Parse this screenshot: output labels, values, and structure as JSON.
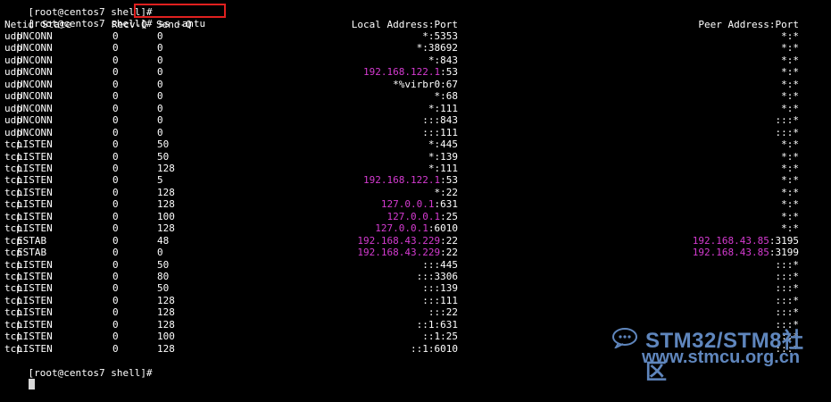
{
  "terminal": {
    "top_partial_prompt": "[root@centos7 shell]#",
    "prompt": "[root@centos7 shell]#",
    "command": " ss -antu",
    "bottom_prompt": "[root@centos7 shell]#",
    "colors": {
      "background": "#000000",
      "text": "#ffffff",
      "highlight": "#d53bd1",
      "annotation_box": "#e0201f"
    }
  },
  "table": {
    "headers": {
      "netid": "Netid",
      "state": "State",
      "recvq": "Recv-Q",
      "sendq": "Send-Q",
      "local": "Local Address:Port",
      "peer": "Peer Address:Port"
    },
    "rows": [
      {
        "netid": "udp",
        "state": "UNCONN",
        "recvq": "0",
        "sendq": "0",
        "local_ip": "",
        "local_rest": "*:5353",
        "peer_ip": "",
        "peer_rest": "*:*"
      },
      {
        "netid": "udp",
        "state": "UNCONN",
        "recvq": "0",
        "sendq": "0",
        "local_ip": "",
        "local_rest": "*:38692",
        "peer_ip": "",
        "peer_rest": "*:*"
      },
      {
        "netid": "udp",
        "state": "UNCONN",
        "recvq": "0",
        "sendq": "0",
        "local_ip": "",
        "local_rest": "*:843",
        "peer_ip": "",
        "peer_rest": "*:*"
      },
      {
        "netid": "udp",
        "state": "UNCONN",
        "recvq": "0",
        "sendq": "0",
        "local_ip": "192.168.122.1",
        "local_rest": ":53",
        "peer_ip": "",
        "peer_rest": "*:*"
      },
      {
        "netid": "udp",
        "state": "UNCONN",
        "recvq": "0",
        "sendq": "0",
        "local_ip": "",
        "local_rest": "*%virbr0:67",
        "peer_ip": "",
        "peer_rest": "*:*"
      },
      {
        "netid": "udp",
        "state": "UNCONN",
        "recvq": "0",
        "sendq": "0",
        "local_ip": "",
        "local_rest": "*:68",
        "peer_ip": "",
        "peer_rest": "*:*"
      },
      {
        "netid": "udp",
        "state": "UNCONN",
        "recvq": "0",
        "sendq": "0",
        "local_ip": "",
        "local_rest": "*:111",
        "peer_ip": "",
        "peer_rest": "*:*"
      },
      {
        "netid": "udp",
        "state": "UNCONN",
        "recvq": "0",
        "sendq": "0",
        "local_ip": "",
        "local_rest": ":::843",
        "peer_ip": "",
        "peer_rest": ":::*"
      },
      {
        "netid": "udp",
        "state": "UNCONN",
        "recvq": "0",
        "sendq": "0",
        "local_ip": "",
        "local_rest": ":::111",
        "peer_ip": "",
        "peer_rest": ":::*"
      },
      {
        "netid": "tcp",
        "state": "LISTEN",
        "recvq": "0",
        "sendq": "50",
        "local_ip": "",
        "local_rest": "*:445",
        "peer_ip": "",
        "peer_rest": "*:*"
      },
      {
        "netid": "tcp",
        "state": "LISTEN",
        "recvq": "0",
        "sendq": "50",
        "local_ip": "",
        "local_rest": "*:139",
        "peer_ip": "",
        "peer_rest": "*:*"
      },
      {
        "netid": "tcp",
        "state": "LISTEN",
        "recvq": "0",
        "sendq": "128",
        "local_ip": "",
        "local_rest": "*:111",
        "peer_ip": "",
        "peer_rest": "*:*"
      },
      {
        "netid": "tcp",
        "state": "LISTEN",
        "recvq": "0",
        "sendq": "5",
        "local_ip": "192.168.122.1",
        "local_rest": ":53",
        "peer_ip": "",
        "peer_rest": "*:*"
      },
      {
        "netid": "tcp",
        "state": "LISTEN",
        "recvq": "0",
        "sendq": "128",
        "local_ip": "",
        "local_rest": "*:22",
        "peer_ip": "",
        "peer_rest": "*:*"
      },
      {
        "netid": "tcp",
        "state": "LISTEN",
        "recvq": "0",
        "sendq": "128",
        "local_ip": "127.0.0.1",
        "local_rest": ":631",
        "peer_ip": "",
        "peer_rest": "*:*"
      },
      {
        "netid": "tcp",
        "state": "LISTEN",
        "recvq": "0",
        "sendq": "100",
        "local_ip": "127.0.0.1",
        "local_rest": ":25",
        "peer_ip": "",
        "peer_rest": "*:*"
      },
      {
        "netid": "tcp",
        "state": "LISTEN",
        "recvq": "0",
        "sendq": "128",
        "local_ip": "127.0.0.1",
        "local_rest": ":6010",
        "peer_ip": "",
        "peer_rest": "*:*"
      },
      {
        "netid": "tcp",
        "state": "ESTAB",
        "recvq": "0",
        "sendq": "48",
        "local_ip": "192.168.43.229",
        "local_rest": ":22",
        "peer_ip": "192.168.43.85",
        "peer_rest": ":3195"
      },
      {
        "netid": "tcp",
        "state": "ESTAB",
        "recvq": "0",
        "sendq": "0",
        "local_ip": "192.168.43.229",
        "local_rest": ":22",
        "peer_ip": "192.168.43.85",
        "peer_rest": ":3199"
      },
      {
        "netid": "tcp",
        "state": "LISTEN",
        "recvq": "0",
        "sendq": "50",
        "local_ip": "",
        "local_rest": ":::445",
        "peer_ip": "",
        "peer_rest": ":::*"
      },
      {
        "netid": "tcp",
        "state": "LISTEN",
        "recvq": "0",
        "sendq": "80",
        "local_ip": "",
        "local_rest": ":::3306",
        "peer_ip": "",
        "peer_rest": ":::*"
      },
      {
        "netid": "tcp",
        "state": "LISTEN",
        "recvq": "0",
        "sendq": "50",
        "local_ip": "",
        "local_rest": ":::139",
        "peer_ip": "",
        "peer_rest": ":::*"
      },
      {
        "netid": "tcp",
        "state": "LISTEN",
        "recvq": "0",
        "sendq": "128",
        "local_ip": "",
        "local_rest": ":::111",
        "peer_ip": "",
        "peer_rest": ":::*"
      },
      {
        "netid": "tcp",
        "state": "LISTEN",
        "recvq": "0",
        "sendq": "128",
        "local_ip": "",
        "local_rest": ":::22",
        "peer_ip": "",
        "peer_rest": ":::*"
      },
      {
        "netid": "tcp",
        "state": "LISTEN",
        "recvq": "0",
        "sendq": "128",
        "local_ip": "",
        "local_rest": "::1:631",
        "peer_ip": "",
        "peer_rest": ":::*"
      },
      {
        "netid": "tcp",
        "state": "LISTEN",
        "recvq": "0",
        "sendq": "100",
        "local_ip": "",
        "local_rest": "::1:25",
        "peer_ip": "",
        "peer_rest": ":::*"
      },
      {
        "netid": "tcp",
        "state": "LISTEN",
        "recvq": "0",
        "sendq": "128",
        "local_ip": "",
        "local_rest": "::1:6010",
        "peer_ip": "",
        "peer_rest": ":::*"
      }
    ]
  },
  "watermark": {
    "title": "STM32/STM8社区",
    "url": "www.stmcu.org.cn",
    "icon": "chat-bubble-icon",
    "color": "#5f86bd"
  }
}
